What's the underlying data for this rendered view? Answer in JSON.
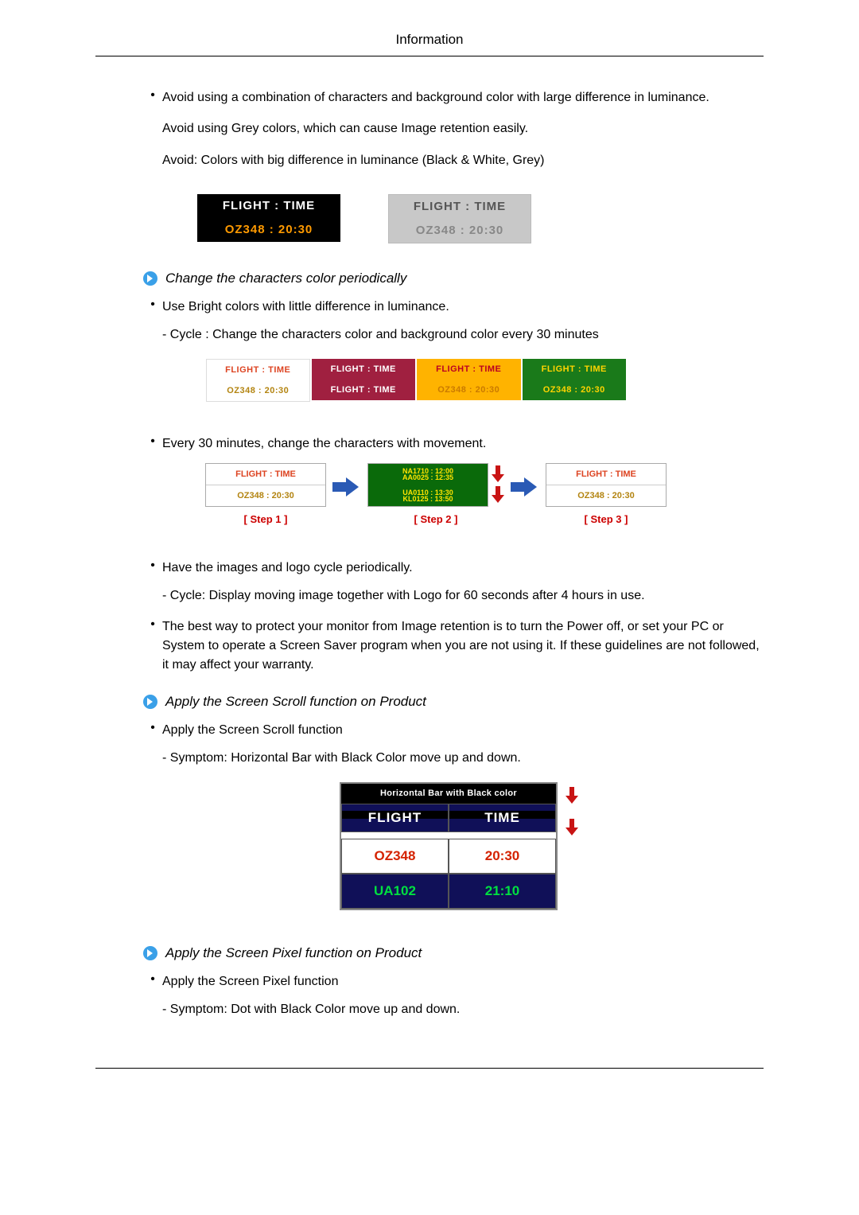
{
  "header": {
    "title": "Information"
  },
  "b1": {
    "line1": "Avoid using a combination of characters and background color with large difference in luminance.",
    "line2": "Avoid using Grey colors, which can cause Image retention easily.",
    "line3": "Avoid: Colors with big difference in luminance (Black & White, Grey)"
  },
  "fig1": {
    "a_top": "FLIGHT : TIME",
    "a_bot": "OZ348   : 20:30",
    "b_top": "FLIGHT : TIME",
    "b_bot": "OZ348   : 20:30"
  },
  "section1": {
    "arrow_heading": "Change the characters color periodically",
    "bullet": "Use Bright colors with little difference in luminance.",
    "dash": "- Cycle : Change the characters color and background color every 30 minutes"
  },
  "fig2": {
    "a_top": "FLIGHT : TIME",
    "a_bot": "OZ348   : 20:30",
    "b_top": "FLIGHT : TIME",
    "b_bot": "FLIGHT : TIME",
    "c_top": "FLIGHT : TIME",
    "c_bot": "OZ348   : 20:30",
    "d_top": "FLIGHT : TIME",
    "d_bot": "OZ348   : 20:30"
  },
  "b2": {
    "text": "Every 30 minutes, change the characters with movement."
  },
  "fig3": {
    "a_top": "FLIGHT : TIME",
    "a_bot": "OZ348   : 20:30",
    "a_step": "[ Step 1 ]",
    "b_top_l1": "NA1710 : 12:00",
    "b_top_l2": "AA0025 : 12:35",
    "b_bot_l1": "UA0110 : 13:30",
    "b_bot_l2": "KL0125 : 13:50",
    "b_step": "[ Step 2 ]",
    "c_top": "FLIGHT : TIME",
    "c_bot": "OZ348   : 20:30",
    "c_step": "[ Step 3 ]"
  },
  "b3": {
    "line1": "Have the images and logo cycle periodically.",
    "dash": "- Cycle: Display moving image together with Logo for 60 seconds after 4 hours in use."
  },
  "b4": {
    "text": "The best way to protect your monitor from Image retention is to turn the Power off, or set your PC or System to operate a Screen Saver program when you are not using it. If these guidelines are not followed, it may affect your warranty."
  },
  "section2": {
    "arrow_heading": "Apply the Screen Scroll function on Product",
    "bullet": "Apply the Screen Scroll function",
    "dash": "- Symptom: Horizontal Bar with Black Color move up and down."
  },
  "fig4": {
    "caption": "Horizontal Bar with Black color",
    "h1": "FLIGHT",
    "h2": "TIME",
    "r1c1": "OZ348",
    "r1c2": "20:30",
    "r2c1": "UA102",
    "r2c2": "21:10"
  },
  "section3": {
    "arrow_heading": "Apply the Screen Pixel function on Product",
    "bullet": "Apply the Screen Pixel function",
    "dash": "- Symptom: Dot with Black Color move up and down."
  }
}
